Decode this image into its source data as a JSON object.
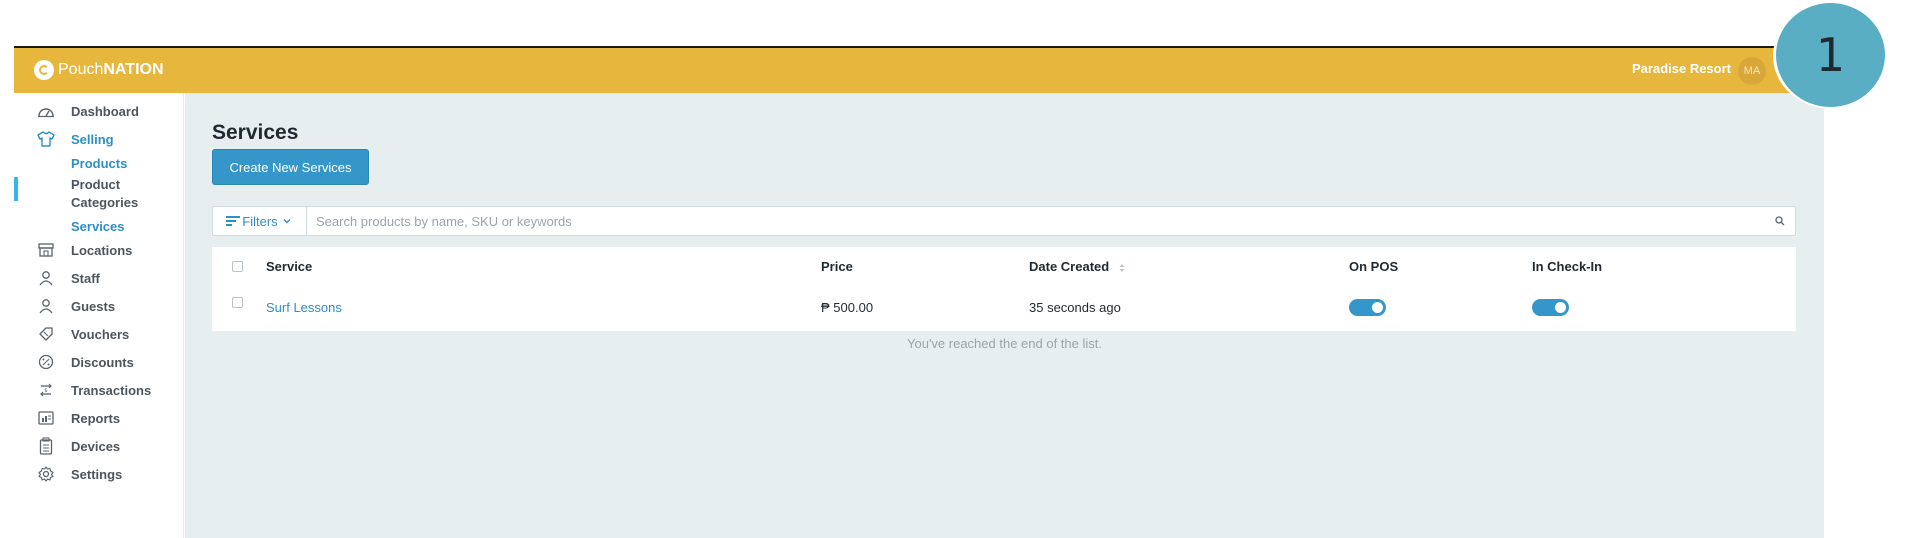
{
  "app": {
    "logo_text_pre": "Pouch",
    "logo_text_bold": "NATION",
    "venue_name": "Paradise Resort",
    "user_initials": "MA"
  },
  "sidebar": {
    "items": [
      {
        "label": "Dashboard",
        "icon": "dashboard-icon"
      },
      {
        "label": "Selling",
        "icon": "shirt-icon",
        "active": true
      },
      {
        "label": "Locations",
        "icon": "store-icon"
      },
      {
        "label": "Staff",
        "icon": "person-icon"
      },
      {
        "label": "Guests",
        "icon": "person-icon"
      },
      {
        "label": "Vouchers",
        "icon": "tag-icon"
      },
      {
        "label": "Discounts",
        "icon": "percent-icon"
      },
      {
        "label": "Transactions",
        "icon": "transactions-icon"
      },
      {
        "label": "Reports",
        "icon": "reports-icon"
      },
      {
        "label": "Devices",
        "icon": "device-icon"
      },
      {
        "label": "Settings",
        "icon": "gear-icon"
      }
    ],
    "sub_items": [
      {
        "label": "Products"
      },
      {
        "label": "Product Categories"
      },
      {
        "label": "Services"
      }
    ]
  },
  "main": {
    "title": "Services",
    "create_button": "Create New Services",
    "filters_label": "Filters",
    "search_placeholder": "Search products by name, SKU or keywords",
    "table": {
      "columns": [
        "Service",
        "Price",
        "Date Created",
        "On POS",
        "In Check-In"
      ],
      "rows": [
        {
          "service": "Surf Lessons",
          "price": "₱ 500.00",
          "date_created": "35 seconds ago",
          "on_pos": true,
          "in_check_in": true
        }
      ]
    },
    "end_of_list": "You've reached the end of the list."
  },
  "badge": {
    "number": "1"
  },
  "colors": {
    "topbar": "#e6b73c",
    "accent": "#3597c9",
    "link": "#2e8fc5",
    "main_bg": "#e6eef0",
    "badge": "#5aaec4"
  }
}
